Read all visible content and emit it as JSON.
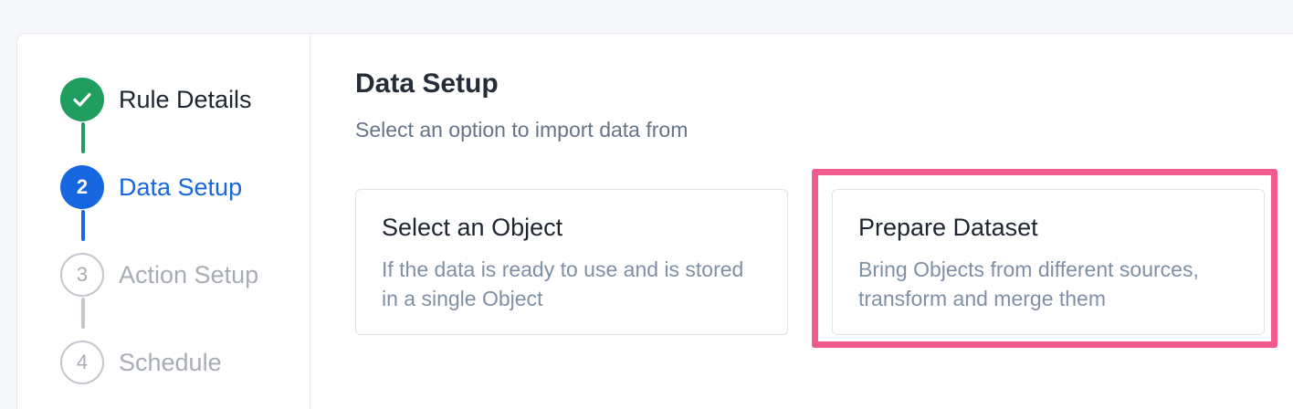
{
  "steps": [
    {
      "number": "",
      "label": "Rule Details",
      "state": "done"
    },
    {
      "number": "2",
      "label": "Data Setup",
      "state": "active"
    },
    {
      "number": "3",
      "label": "Action Setup",
      "state": "pending"
    },
    {
      "number": "4",
      "label": "Schedule",
      "state": "pending"
    }
  ],
  "main": {
    "title": "Data Setup",
    "subtitle": "Select an option to import data from",
    "options": [
      {
        "title": "Select an Object",
        "description": "If the data is ready to use and is stored in a single Object"
      },
      {
        "title": "Prepare Dataset",
        "description": "Bring Objects from different sources, transform and merge them",
        "highlighted": true
      }
    ]
  },
  "colors": {
    "done": "#1f9e60",
    "active": "#1767e0",
    "pending": "#c3c8cf",
    "highlight": "#ef5b8c"
  },
  "icons": {
    "done_step": "check-icon"
  }
}
